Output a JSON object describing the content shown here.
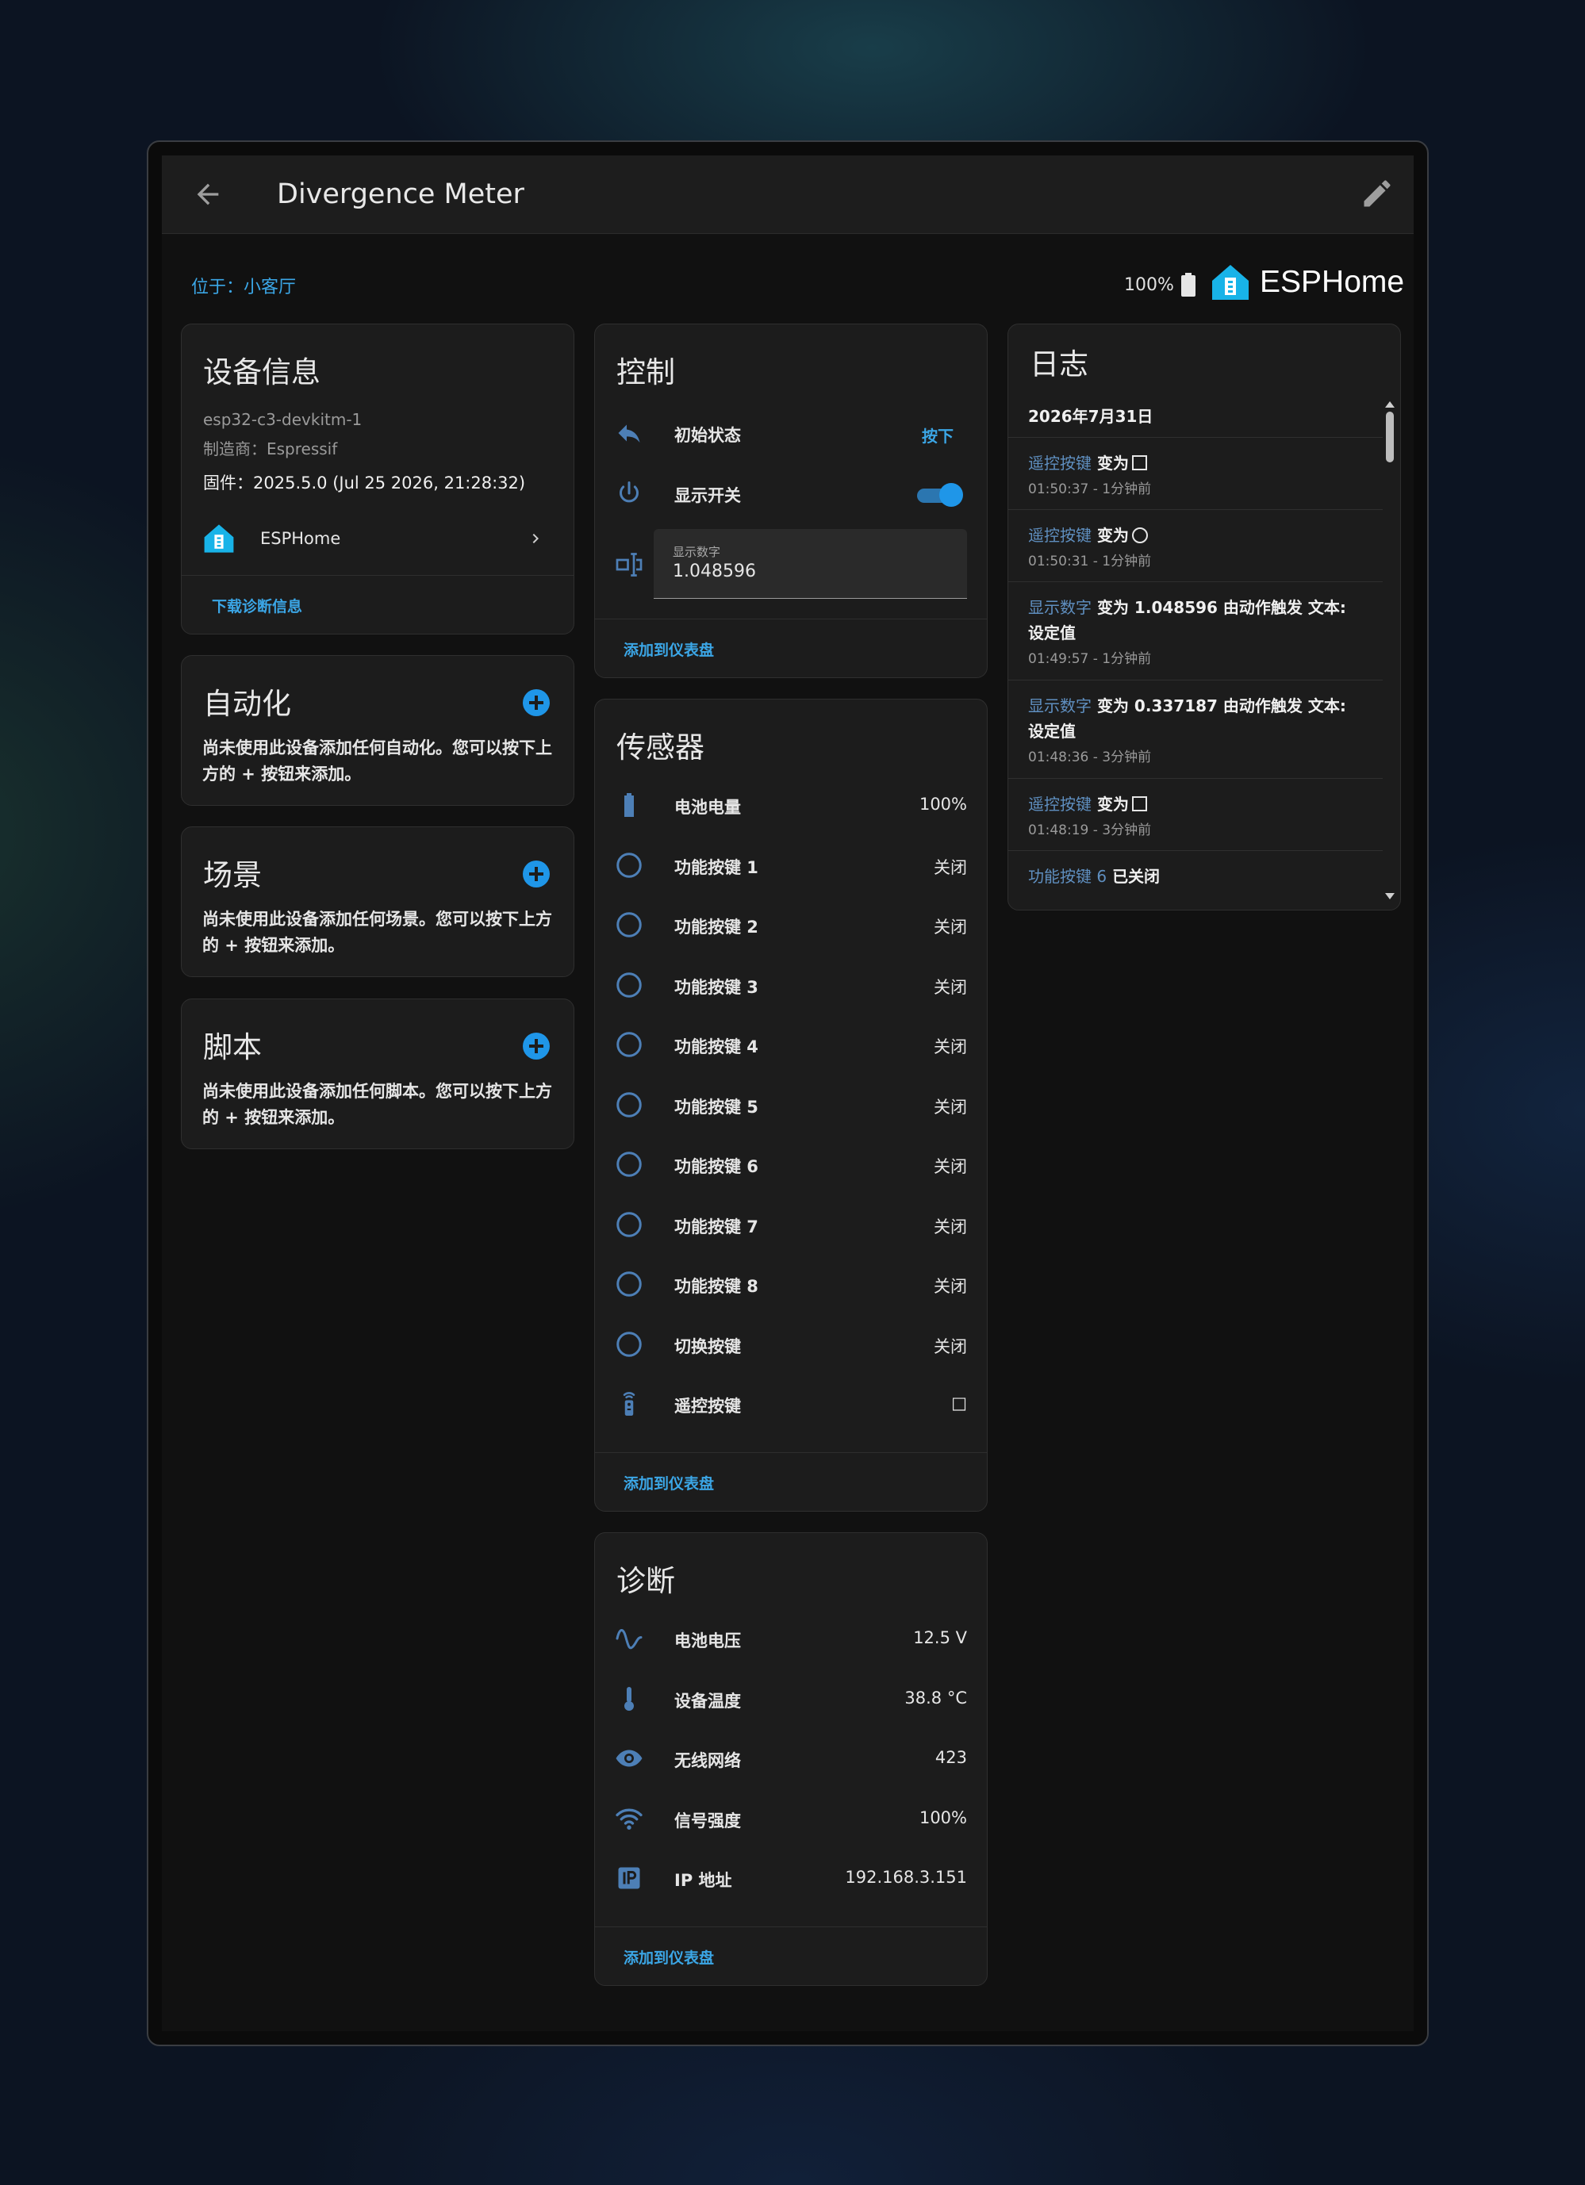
{
  "header": {
    "title": "Divergence Meter"
  },
  "top": {
    "area_link": "位于：小客厅",
    "battery": "100%",
    "brand": "ESPHome"
  },
  "device_info": {
    "title": "设备信息",
    "model": "esp32-c3-devkitm-1",
    "manufacturer": "制造商：Espressif",
    "firmware": "固件：2025.5.0 (Jul 25 2026, 21:28:32)",
    "integration": "ESPHome",
    "download": "下载诊断信息"
  },
  "automation": {
    "title": "自动化",
    "text": "尚未使用此设备添加任何自动化。您可以按下上方的 + 按钮来添加。"
  },
  "scenes": {
    "title": "场景",
    "text": "尚未使用此设备添加任何场景。您可以按下上方的 + 按钮来添加。"
  },
  "scripts": {
    "title": "脚本",
    "text": "尚未使用此设备添加任何脚本。您可以按下上方的 + 按钮来添加。"
  },
  "control": {
    "title": "控制",
    "initial_state": {
      "label": "初始状态",
      "action": "按下"
    },
    "display_switch": {
      "label": "显示开关",
      "on": true
    },
    "display_number": {
      "label": "显示数字",
      "value": "1.048596"
    },
    "add_dashboard": "添加到仪表盘"
  },
  "sensors": {
    "title": "传感器",
    "items": [
      {
        "label": "电池电量",
        "value": "100%",
        "icon": "battery-icon"
      },
      {
        "label": "功能按键 1",
        "value": "关闭",
        "icon": "circle-outline-icon"
      },
      {
        "label": "功能按键 2",
        "value": "关闭",
        "icon": "circle-outline-icon"
      },
      {
        "label": "功能按键 3",
        "value": "关闭",
        "icon": "circle-outline-icon"
      },
      {
        "label": "功能按键 4",
        "value": "关闭",
        "icon": "circle-outline-icon"
      },
      {
        "label": "功能按键 5",
        "value": "关闭",
        "icon": "circle-outline-icon"
      },
      {
        "label": "功能按键 6",
        "value": "关闭",
        "icon": "circle-outline-icon"
      },
      {
        "label": "功能按键 7",
        "value": "关闭",
        "icon": "circle-outline-icon"
      },
      {
        "label": "功能按键 8",
        "value": "关闭",
        "icon": "circle-outline-icon"
      },
      {
        "label": "切换按键",
        "value": "关闭",
        "icon": "circle-outline-icon"
      },
      {
        "label": "遥控按键",
        "value": "□",
        "icon": "remote-icon"
      }
    ],
    "add_dashboard": "添加到仪表盘"
  },
  "diagnostics": {
    "title": "诊断",
    "items": [
      {
        "label": "电池电压",
        "value": "12.5 V",
        "icon": "sine-wave-icon"
      },
      {
        "label": "设备温度",
        "value": "38.8 °C",
        "icon": "thermometer-icon"
      },
      {
        "label": "无线网络",
        "value": "423",
        "icon": "eye-icon"
      },
      {
        "label": "信号强度",
        "value": "100%",
        "icon": "wifi-icon"
      },
      {
        "label": "IP 地址",
        "value": "192.168.3.151",
        "icon": "ip-icon"
      }
    ],
    "add_dashboard": "添加到仪表盘"
  },
  "logbook": {
    "title": "日志",
    "date": "2026年7月31日",
    "entries": [
      {
        "entity": "遥控按键",
        "msg": "变为",
        "glyph": "square",
        "time": "01:50:37 - 1分钟前"
      },
      {
        "entity": "遥控按键",
        "msg": "变为",
        "glyph": "circle",
        "time": "01:50:31 - 1分钟前"
      },
      {
        "entity": "显示数字",
        "msg": "变为 1.048596 由动作触发 文本: 设定值",
        "time": "01:49:57 - 1分钟前"
      },
      {
        "entity": "显示数字",
        "msg": "变为 0.337187 由动作触发 文本: 设定值",
        "time": "01:48:36 - 3分钟前"
      },
      {
        "entity": "遥控按键",
        "msg": "变为",
        "glyph": "square",
        "time": "01:48:19 - 3分钟前"
      },
      {
        "entity": "功能按键 6",
        "msg": "已关闭"
      }
    ]
  },
  "colors": {
    "accent": "#1f96e8",
    "link": "#3ba6e6",
    "icon": "#4d7fb6",
    "card": "#1c1c1c"
  }
}
